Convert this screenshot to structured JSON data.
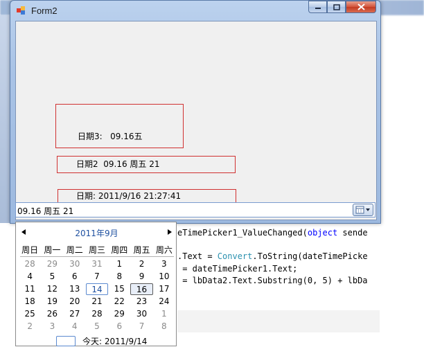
{
  "window": {
    "title": "Form2"
  },
  "caption_buttons": {
    "minimize": "▁",
    "maximize": "▢",
    "close": "✕"
  },
  "labels": {
    "date3": "日期3:   09.16五",
    "date2": "日期2  09.16 周五 21",
    "date1": "日期: 2011/9/16 21:27:41"
  },
  "datepicker": {
    "value": "09.16 周五 21"
  },
  "calendar": {
    "title": "2011年9月",
    "weekdays": [
      "周日",
      "周一",
      "周二",
      "周三",
      "周四",
      "周五",
      "周六"
    ],
    "weeks": [
      [
        "28",
        "29",
        "30",
        "31",
        "1",
        "2",
        "3"
      ],
      [
        "4",
        "5",
        "6",
        "7",
        "8",
        "9",
        "10"
      ],
      [
        "11",
        "12",
        "13",
        "14",
        "15",
        "16",
        "17"
      ],
      [
        "18",
        "19",
        "20",
        "21",
        "22",
        "23",
        "24"
      ],
      [
        "25",
        "26",
        "27",
        "28",
        "29",
        "30",
        "1"
      ],
      [
        "2",
        "3",
        "4",
        "5",
        "6",
        "7",
        "8"
      ]
    ],
    "today": "今天: 2011/9/14"
  },
  "code": {
    "line1_pre": "eTimePicker1_ValueChanged(",
    "line1_kw": "object",
    "line1_post": " sende",
    "line2_pre": ".Text = ",
    "line2_ty": "Convert",
    "line2_post": ".ToString(dateTimePicke",
    "line3": " = dateTimePicker1.Text;",
    "line4": " = lbData2.Text.Substring(0, 5) + lbDa"
  },
  "colors": {
    "accent_red": "#d03030",
    "link_blue": "#1e50a0"
  }
}
